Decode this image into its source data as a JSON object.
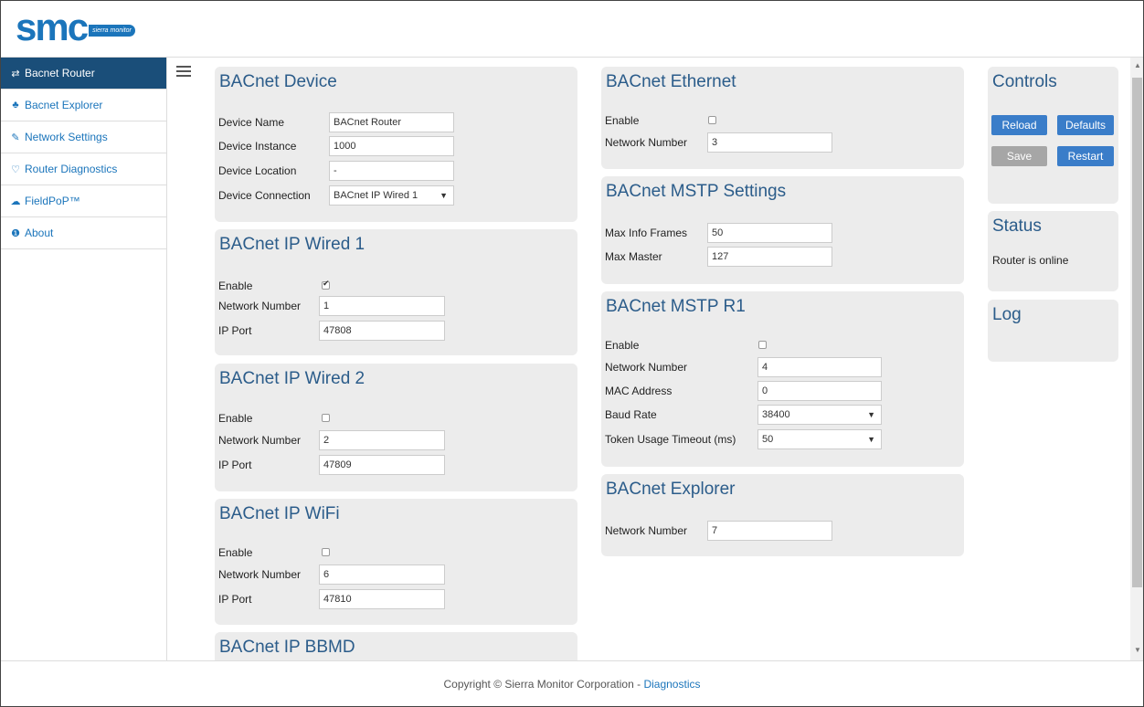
{
  "brand": {
    "logo_text": "smc",
    "logo_tag": "sierra monitor"
  },
  "sidebar": {
    "items": [
      {
        "icon": "⇄",
        "label": "Bacnet Router",
        "active": true
      },
      {
        "icon": "♣",
        "label": "Bacnet Explorer"
      },
      {
        "icon": "✎",
        "label": "Network Settings"
      },
      {
        "icon": "♡",
        "label": "Router Diagnostics"
      },
      {
        "icon": "☁",
        "label": "FieldPoP™"
      },
      {
        "icon": "❶",
        "label": "About"
      }
    ]
  },
  "device": {
    "title": "BACnet Device",
    "name_label": "Device Name",
    "name_value": "BACnet Router",
    "instance_label": "Device Instance",
    "instance_value": "1000",
    "location_label": "Device Location",
    "location_value": "-",
    "connection_label": "Device Connection",
    "connection_value": "BACnet IP Wired 1"
  },
  "ip_wired1": {
    "title": "BACnet IP Wired 1",
    "enable_label": "Enable",
    "enabled": true,
    "network_label": "Network Number",
    "network_value": "1",
    "port_label": "IP Port",
    "port_value": "47808"
  },
  "ip_wired2": {
    "title": "BACnet IP Wired 2",
    "enable_label": "Enable",
    "enabled": false,
    "network_label": "Network Number",
    "network_value": "2",
    "port_label": "IP Port",
    "port_value": "47809"
  },
  "ip_wifi": {
    "title": "BACnet IP WiFi",
    "enable_label": "Enable",
    "enabled": false,
    "network_label": "Network Number",
    "network_value": "6",
    "port_label": "IP Port",
    "port_value": "47810"
  },
  "ip_bbmd": {
    "title": "BACnet IP BBMD"
  },
  "ethernet": {
    "title": "BACnet Ethernet",
    "enable_label": "Enable",
    "enabled": false,
    "network_label": "Network Number",
    "network_value": "3"
  },
  "mstp_settings": {
    "title": "BACnet MSTP Settings",
    "max_info_label": "Max Info Frames",
    "max_info_value": "50",
    "max_master_label": "Max Master",
    "max_master_value": "127"
  },
  "mstp_r1": {
    "title": "BACnet MSTP R1",
    "enable_label": "Enable",
    "enabled": false,
    "network_label": "Network Number",
    "network_value": "4",
    "mac_label": "MAC Address",
    "mac_value": "0",
    "baud_label": "Baud Rate",
    "baud_value": "38400",
    "token_label": "Token Usage Timeout (ms)",
    "token_value": "50"
  },
  "explorer": {
    "title": "BACnet Explorer",
    "network_label": "Network Number",
    "network_value": "7"
  },
  "controls": {
    "title": "Controls",
    "reload": "Reload",
    "defaults": "Defaults",
    "save": "Save",
    "restart": "Restart"
  },
  "status": {
    "title": "Status",
    "text": "Router is online"
  },
  "log": {
    "title": "Log"
  },
  "footer": {
    "copyright": "Copyright © Sierra Monitor Corporation - ",
    "link": "Diagnostics"
  }
}
